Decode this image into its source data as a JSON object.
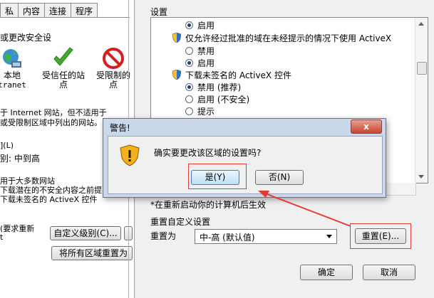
{
  "internet_options": {
    "tabs": [
      "私",
      "内容",
      "连接",
      "程序"
    ],
    "zone_heading": "或更改安全设",
    "zones": [
      {
        "label": "本地",
        "sub": "tranet"
      },
      {
        "label": "受信任的站",
        "sub": "点"
      },
      {
        "label": "受限制的",
        "sub": "点"
      }
    ],
    "zone_description": [
      "于 Internet 网站，但不适用于",
      "或受限制区域中列出的网站。"
    ],
    "level_label": "](L)",
    "level_allowed": "别: 中到高",
    "medhigh_lines": [
      "用于大多数网站",
      "下载潜在的不安全内容之前提",
      "下载未签名的 ActiveX 控件"
    ],
    "restart_note": [
      "(要求重新",
      "t"
    ],
    "custom_level_button": "自定义级别(C)...",
    "reset_all_button": "将所有区域重置为"
  },
  "security_settings": {
    "group_title": "设置",
    "rows": [
      {
        "type": "radio",
        "checked": true,
        "text": "启用"
      },
      {
        "type": "item",
        "text": "仅允许经过批准的域在未经提示的情况下使用 ActiveX"
      },
      {
        "type": "radio",
        "checked": false,
        "text": "禁用"
      },
      {
        "type": "radio",
        "checked": true,
        "text": "启用"
      },
      {
        "type": "item",
        "text": "下载未签名的 ActiveX 控件"
      },
      {
        "type": "radio",
        "checked": true,
        "text": "禁用 (推荐)"
      },
      {
        "type": "radio",
        "checked": false,
        "text": "启用 (不安全)"
      },
      {
        "type": "radio",
        "checked": false,
        "text": "提示"
      }
    ],
    "note": "*在重新启动你的计算机后生效",
    "reset_group_title": "重置自定义设置",
    "reset_to_label": "重置为",
    "reset_level_value": "中-高 (默认值)",
    "reset_button": "重置(E)...",
    "ok_button": "确定",
    "cancel_button": "取消"
  },
  "confirm_dialog": {
    "title": "警告!",
    "close_label": "x",
    "message": "确实要更改该区域的设置吗?",
    "yes_button": "是(Y)",
    "no_button": "否(N)"
  },
  "colors": {
    "annotation_red": "#e53935",
    "dialog_frame": "#c9d8ea",
    "check_green": "#3fae29",
    "restricted_red": "#d51f1f"
  }
}
